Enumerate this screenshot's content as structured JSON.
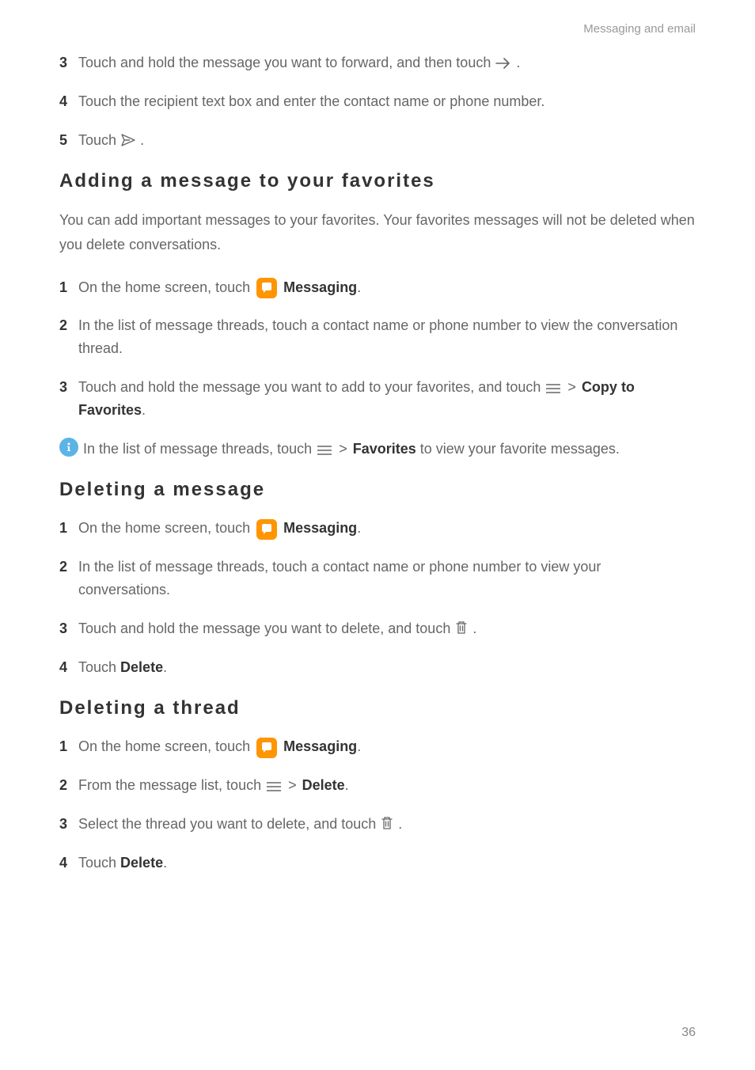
{
  "header": "Messaging and email",
  "intro_steps": {
    "s3_a": "Touch and hold the message you want to forward, and then touch ",
    "s3_b": ".",
    "s4": "Touch the recipient text box and enter the contact name or phone number.",
    "s5_a": "Touch ",
    "s5_b": "."
  },
  "section1": {
    "heading": "Adding a message to your favorites",
    "body": "You can add important messages to your favorites. Your favorites messages will not be deleted when you delete conversations.",
    "s1_a": "On the home screen, touch ",
    "s1_b": "Messaging",
    "s1_c": ".",
    "s2": "In the list of message threads, touch a contact name or phone number to view the conversation thread.",
    "s3_a": "Touch and hold the message you want to add to your favorites, and touch ",
    "s3_gt": ">",
    "s3_bold": "Copy to Favorites",
    "s3_c": ".",
    "info_a": "In the list of message threads, touch ",
    "info_gt": ">",
    "info_bold": "Favorites",
    "info_b": " to view your favorite messages."
  },
  "section2": {
    "heading": "Deleting a message",
    "s1_a": "On the home screen, touch ",
    "s1_b": "Messaging",
    "s1_c": ".",
    "s2": "In the list of message threads, touch a contact name or phone number to view your conversations.",
    "s3_a": "Touch and hold the message you want to delete, and touch ",
    "s3_b": ".",
    "s4_a": "Touch ",
    "s4_bold": "Delete",
    "s4_b": "."
  },
  "section3": {
    "heading": "Deleting a thread",
    "s1_a": "On the home screen, touch ",
    "s1_b": "Messaging",
    "s1_c": ".",
    "s2_a": "From the message list, touch ",
    "s2_gt": ">",
    "s2_bold": "Delete",
    "s2_b": ".",
    "s3_a": "Select the thread you want to delete, and touch ",
    "s3_b": ".",
    "s4_a": "Touch ",
    "s4_bold": "Delete",
    "s4_b": "."
  },
  "nums": {
    "n1": "1",
    "n2": "2",
    "n3": "3",
    "n4": "4",
    "n5": "5"
  },
  "page_num": "36"
}
